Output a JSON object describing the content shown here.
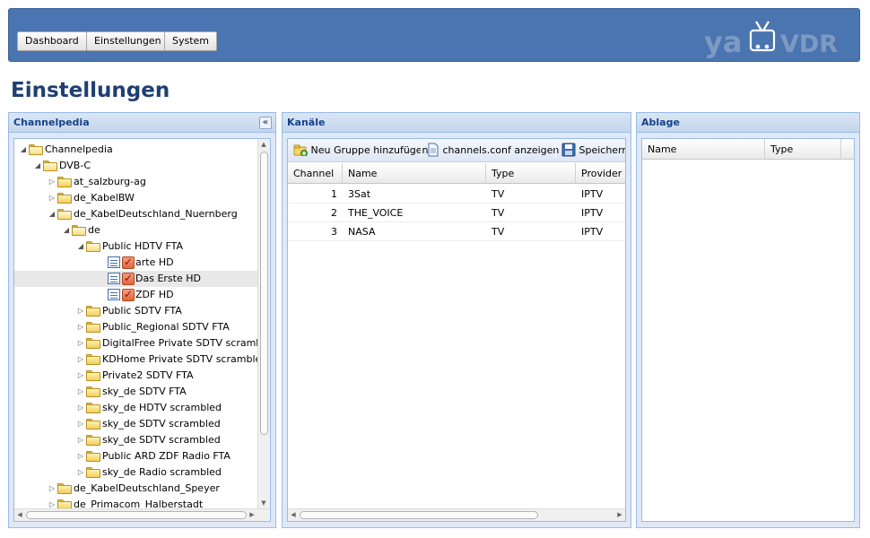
{
  "nav": {
    "dashboard": "Dashboard",
    "settings": "Einstellungen",
    "system": "System"
  },
  "logo": {
    "left": "ya",
    "right": "VDR"
  },
  "page_title": "Einstellungen",
  "channelpedia": {
    "title": "Channelpedia",
    "tree": [
      {
        "label": "Channelpedia",
        "depth": 0,
        "state": "open",
        "kind": "folder"
      },
      {
        "label": "DVB-C",
        "depth": 1,
        "state": "open",
        "kind": "folder"
      },
      {
        "label": "at_salzburg-ag",
        "depth": 2,
        "state": "closed",
        "kind": "folder"
      },
      {
        "label": "de_KabelBW",
        "depth": 2,
        "state": "closed",
        "kind": "folder"
      },
      {
        "label": "de_KabelDeutschland_Nuernberg",
        "depth": 2,
        "state": "open",
        "kind": "folder"
      },
      {
        "label": "de",
        "depth": 3,
        "state": "open",
        "kind": "folder"
      },
      {
        "label": "Public HDTV FTA",
        "depth": 4,
        "state": "open",
        "kind": "folder"
      },
      {
        "label": "arte HD",
        "depth": 5,
        "state": "leaf",
        "kind": "channel"
      },
      {
        "label": "Das Erste HD",
        "depth": 5,
        "state": "leaf",
        "kind": "channel",
        "selected": true
      },
      {
        "label": "ZDF HD",
        "depth": 5,
        "state": "leaf",
        "kind": "channel"
      },
      {
        "label": "Public SDTV FTA",
        "depth": 4,
        "state": "closed",
        "kind": "folder"
      },
      {
        "label": "Public_Regional SDTV FTA",
        "depth": 4,
        "state": "closed",
        "kind": "folder"
      },
      {
        "label": "DigitalFree Private SDTV scrambled",
        "depth": 4,
        "state": "closed",
        "kind": "folder"
      },
      {
        "label": "KDHome Private SDTV scrambled",
        "depth": 4,
        "state": "closed",
        "kind": "folder"
      },
      {
        "label": "Private2 SDTV FTA",
        "depth": 4,
        "state": "closed",
        "kind": "folder"
      },
      {
        "label": "sky_de SDTV FTA",
        "depth": 4,
        "state": "closed",
        "kind": "folder"
      },
      {
        "label": "sky_de HDTV scrambled",
        "depth": 4,
        "state": "closed",
        "kind": "folder"
      },
      {
        "label": "sky_de SDTV scrambled",
        "depth": 4,
        "state": "closed",
        "kind": "folder"
      },
      {
        "label": "sky_de SDTV scrambled",
        "depth": 4,
        "state": "closed",
        "kind": "folder"
      },
      {
        "label": "Public ARD ZDF Radio FTA",
        "depth": 4,
        "state": "closed",
        "kind": "folder"
      },
      {
        "label": "sky_de Radio scrambled",
        "depth": 4,
        "state": "closed",
        "kind": "folder"
      },
      {
        "label": "de_KabelDeutschland_Speyer",
        "depth": 2,
        "state": "closed",
        "kind": "folder"
      },
      {
        "label": "de_Primacom_Halberstadt",
        "depth": 2,
        "state": "closed",
        "kind": "folder"
      }
    ]
  },
  "kanaele": {
    "title": "Kanäle",
    "toolbar": {
      "add_group": "Neu Gruppe hinzufügen",
      "show_conf": "channels.conf anzeigen",
      "save": "Speichern"
    },
    "columns": [
      "Channel",
      "Name",
      "Type",
      "Provider"
    ],
    "rows": [
      [
        "1",
        "3Sat",
        "TV",
        "IPTV"
      ],
      [
        "2",
        "THE_VOICE",
        "TV",
        "IPTV"
      ],
      [
        "3",
        "NASA",
        "TV",
        "IPTV"
      ]
    ]
  },
  "ablage": {
    "title": "Ablage",
    "columns": [
      "Name",
      "Type"
    ]
  }
}
